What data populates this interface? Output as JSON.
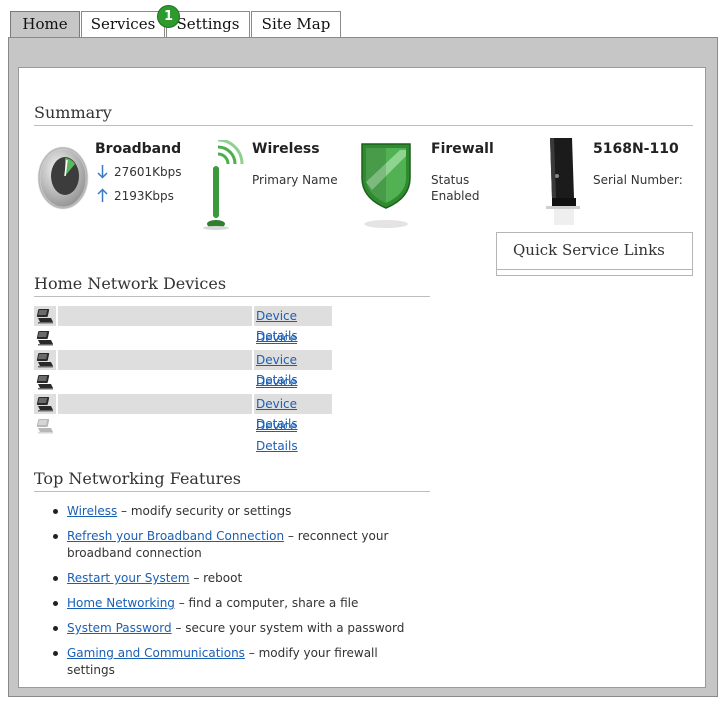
{
  "tabs": [
    {
      "label": "Home",
      "active": true
    },
    {
      "label": "Services",
      "active": false
    },
    {
      "label": "Settings",
      "active": false
    },
    {
      "label": "Site Map",
      "active": false
    }
  ],
  "step_badge": "1",
  "summary": {
    "title": "Summary",
    "broadband": {
      "title": "Broadband",
      "down": "27601Kbps",
      "up": "2193Kbps"
    },
    "wireless": {
      "title": "Wireless",
      "line1": "Primary Name"
    },
    "firewall": {
      "title": "Firewall",
      "line1": "Status",
      "line2": "Enabled"
    },
    "device": {
      "title": "5168N-110",
      "line1": "Serial Number:"
    }
  },
  "quick_links": {
    "title": "Quick Service Links"
  },
  "home_network": {
    "title": "Home Network Devices",
    "link_label": "Device Details",
    "rows": [
      {
        "shaded": true,
        "active": true
      },
      {
        "shaded": false,
        "active": true
      },
      {
        "shaded": true,
        "active": true
      },
      {
        "shaded": false,
        "active": true
      },
      {
        "shaded": true,
        "active": true
      },
      {
        "shaded": false,
        "active": false
      }
    ]
  },
  "features": {
    "title": "Top Networking Features",
    "items": [
      {
        "link": "Wireless",
        "text": " – modify security or settings"
      },
      {
        "link": "Refresh your Broadband Connection",
        "text": " – reconnect your broadband connection"
      },
      {
        "link": "Restart your System",
        "text": " – reboot"
      },
      {
        "link": "Home Networking",
        "text": " – find a computer, share a file"
      },
      {
        "link": "System Password",
        "text": " – secure your system with a password"
      },
      {
        "link": "Gaming and Communications",
        "text": " – modify your firewall settings"
      }
    ]
  },
  "colors": {
    "accent_green": "#2e9a2e",
    "link_blue": "#1a5fb4",
    "frame_gray": "#c6c6c6"
  }
}
